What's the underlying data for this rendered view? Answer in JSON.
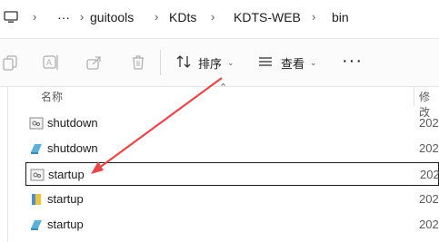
{
  "address": {
    "dots": "···",
    "crumbs": [
      "guitools",
      "KDts",
      "KDTS-WEB",
      "bin"
    ],
    "separator": "›"
  },
  "toolbar": {
    "sort_label": "排序",
    "view_label": "查看",
    "more_label": "···"
  },
  "columns": {
    "name": "名称",
    "modified": "修改"
  },
  "files": [
    {
      "name": "shutdown",
      "modified": "202",
      "icon": "batch-file-icon"
    },
    {
      "name": "shutdown",
      "modified": "202",
      "icon": "shell-script-icon"
    },
    {
      "name": "startup",
      "modified": "202",
      "icon": "batch-file-icon",
      "selected": true
    },
    {
      "name": "startup",
      "modified": "202",
      "icon": "exe-icon"
    },
    {
      "name": "startup",
      "modified": "202",
      "icon": "shell-script-icon"
    }
  ],
  "colors": {
    "arrow": "#e8474a",
    "accent": "#0067c0"
  }
}
